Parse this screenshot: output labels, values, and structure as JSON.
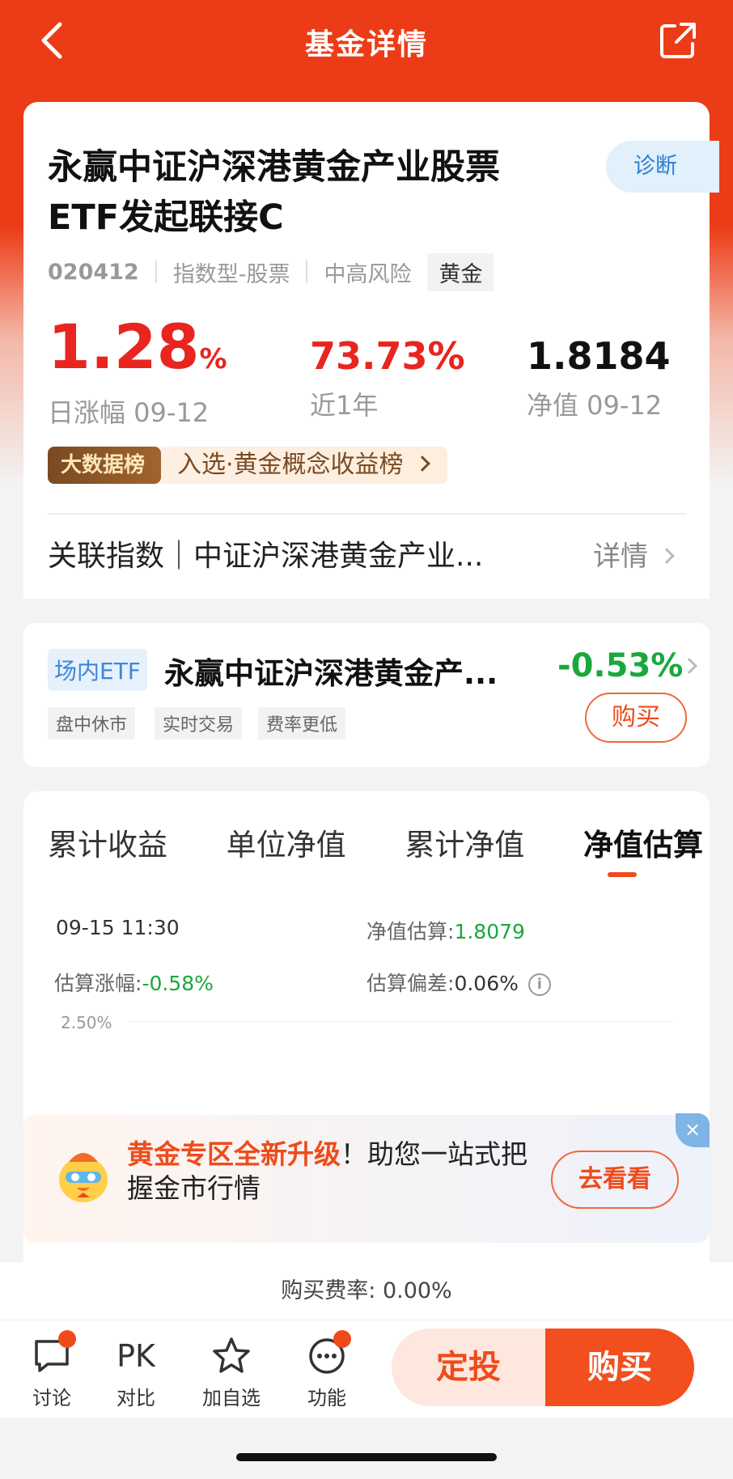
{
  "header": {
    "title": "基金详情"
  },
  "fund": {
    "name_line1": "永赢中证沪深港黄金产业股票",
    "name_line2": "ETF发起联接C",
    "diagnose": "诊断",
    "code": "020412",
    "type": "指数型-股票",
    "risk": "中高风险",
    "tag": "黄金",
    "daily_change": "1.28",
    "daily_change_unit": "%",
    "daily_label": "日涨幅 09-12",
    "year_return": "73.73%",
    "year_label": "近1年",
    "nav": "1.8184",
    "nav_label": "净值 09-12",
    "rank_badge": "大数据榜",
    "rank_text": "入选·黄金概念收益榜",
    "related_index": "关联指数｜中证沪深港黄金产业...",
    "related_detail": "详情"
  },
  "etf": {
    "tag": "场内ETF",
    "name": "永赢中证沪深港黄金产...",
    "change": "-0.53%",
    "chips": [
      "盘中休市",
      "实时交易",
      "费率更低"
    ],
    "buy": "购买"
  },
  "tabs": [
    {
      "label": "累计收益",
      "active": false
    },
    {
      "label": "单位净值",
      "active": false
    },
    {
      "label": "累计净值",
      "active": false
    },
    {
      "label": "净值估算",
      "active": true
    }
  ],
  "estimate": {
    "time": "09-15 11:30",
    "nav_label": "净值估算:",
    "nav_value": "1.8079",
    "change_label": "估算涨幅:",
    "change_value": "-0.58%",
    "deviation_label": "估算偏差:",
    "deviation_value": "0.06%",
    "y_tick_top": "2.50%"
  },
  "banner": {
    "highlight": "黄金专区全新升级",
    "text": "！助您一站式把握金市行情",
    "button": "去看看",
    "close": "×"
  },
  "fee": {
    "text": "购买费率: 0.00%"
  },
  "bottom_nav": [
    {
      "label": "讨论",
      "icon": "chat-icon"
    },
    {
      "label": "对比",
      "icon": "pk-icon",
      "glyph": "PK"
    },
    {
      "label": "加自选",
      "icon": "star-icon"
    },
    {
      "label": "功能",
      "icon": "more-icon"
    }
  ],
  "actions": {
    "sip": "定投",
    "buy": "购买"
  },
  "colors": {
    "brand": "#ef4b1a",
    "up": "#e8251e",
    "down": "#1aa83c"
  }
}
